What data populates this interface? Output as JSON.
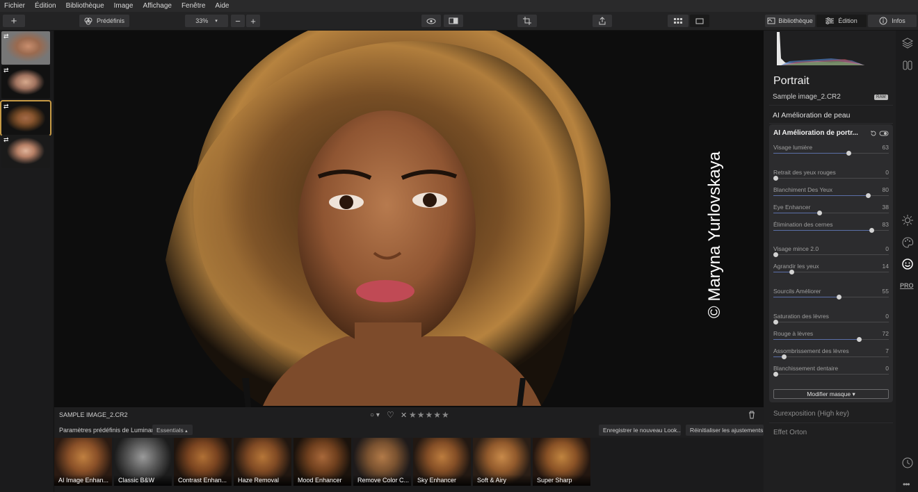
{
  "menu": [
    "Fichier",
    "Édition",
    "Bibliothèque",
    "Image",
    "Affichage",
    "Fenêtre",
    "Aide"
  ],
  "toolbar": {
    "add": "+",
    "presets_label": "Prédéfinis",
    "zoom": "33%",
    "zoom_out": "−",
    "zoom_in": "+",
    "tab_library": "Bibliothèque",
    "tab_edit": "Édition",
    "tab_info": "Infos"
  },
  "viewer": {
    "watermark": "© Maryna Yurlovskaya"
  },
  "infobar": {
    "filename": "SAMPLE IMAGE_2.CR2",
    "stars": "★★★★★",
    "reject": "✕",
    "heart": "♡",
    "circle": "○ ▾"
  },
  "presetbar": {
    "label": "Paramètres prédéfinis de Luminar :",
    "collection": "Essentials",
    "save": "Enregistrer le nouveau Look...",
    "reset": "Réinitialiser les ajustements"
  },
  "presets": [
    "AI Image Enhan...",
    "Classic B&W",
    "Contrast Enhan...",
    "Haze Removal",
    "Mood Enhancer",
    "Remove Color C...",
    "Sky Enhancer",
    "Soft & Airy",
    "Super Sharp"
  ],
  "right": {
    "section_title": "Portrait",
    "file": "Sample image_2.CR2",
    "raw_badge": "RAW",
    "skin_tool": "AI Amélioration de peau",
    "panel_title": "AI Amélioration de portr...",
    "mask_button": "Modifier masque ▾",
    "below1": "Surexposition (High key)",
    "below2": "Effet Orton"
  },
  "sliders": [
    {
      "label": "Visage lumière",
      "value": "63",
      "frac": 0.63,
      "bip": false
    },
    {
      "label": "Retrait des yeux rouges",
      "value": "0",
      "frac": 0,
      "bip": false
    },
    {
      "label": "Blanchiment Des Yeux",
      "value": "80",
      "frac": 0.8,
      "bip": false
    },
    {
      "label": "Eye Enhancer",
      "value": "38",
      "frac": 0.38,
      "bip": false
    },
    {
      "label": "Élimination des cernes",
      "value": "83",
      "frac": 0.83,
      "bip": false
    },
    {
      "label": "Visage mince 2.0",
      "value": "0",
      "frac": 0,
      "bip": false
    },
    {
      "label": "Agrandir les yeux",
      "value": "14",
      "frac": 0.14,
      "bip": false
    },
    {
      "label": "Sourcils Améliorer",
      "value": "55",
      "frac": 0.55,
      "bip": false
    },
    {
      "label": "Saturation des lèvres",
      "value": "0",
      "frac": 0,
      "bip": false
    },
    {
      "label": "Rouge à lèvres",
      "value": "72",
      "frac": 0.72,
      "bip": false
    },
    {
      "label": "Assombrissement des lèvres",
      "value": "7",
      "frac": 0.07,
      "bip": false
    },
    {
      "label": "Blanchissement dentaire",
      "value": "0",
      "frac": 0,
      "bip": false
    }
  ],
  "colors": {
    "accent": "#c79a45",
    "slider_fill": "#5b6fa8",
    "panel": "#2c2c2e"
  },
  "icons": [
    "layers-icon",
    "compare-panel-icon",
    "sun-icon",
    "palette-icon",
    "smile-icon",
    "pro-icon",
    "clock-icon",
    "more-icon"
  ],
  "pro_label": "PRO"
}
